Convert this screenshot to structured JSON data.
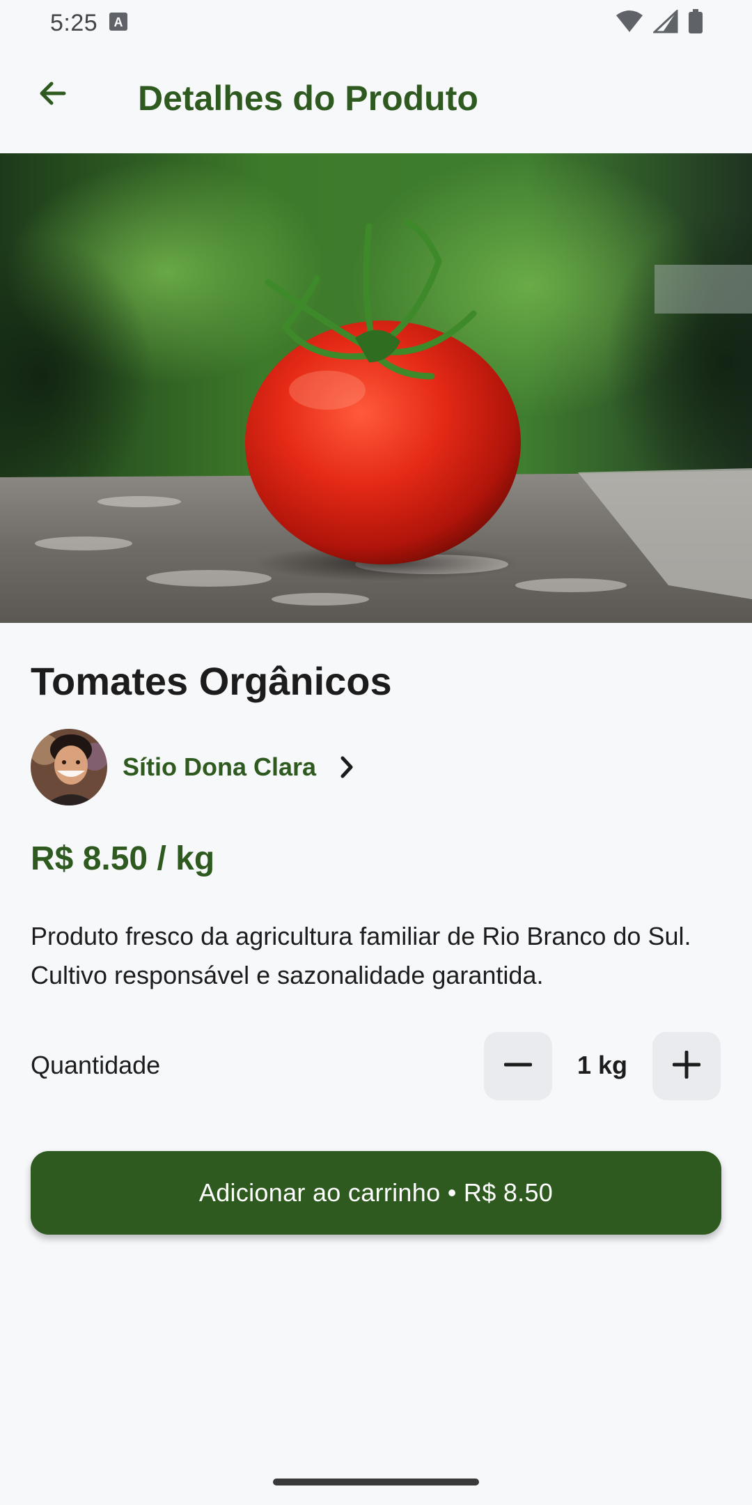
{
  "status_bar": {
    "time": "5:25",
    "icons": [
      "text-a-notification-icon",
      "wifi-icon",
      "cellular-signal-icon",
      "battery-icon"
    ]
  },
  "app_bar": {
    "back_icon": "arrow-left-icon",
    "title": "Detalhes do Produto"
  },
  "product": {
    "image": "tomato-photo",
    "title": "Tomates Orgânicos",
    "seller": {
      "avatar": "seller-avatar",
      "name": "Sítio Dona Clara",
      "chevron_icon": "chevron-right-icon"
    },
    "price": "R$ 8.50 / kg",
    "description": "Produto fresco da agricultura familiar de Rio Branco do Sul. Cultivo responsável e sazonalidade garantida."
  },
  "quantity": {
    "label": "Quantidade",
    "value": "1 kg",
    "decrement_icon": "minus-icon",
    "increment_icon": "plus-icon"
  },
  "cart_button": {
    "label": "Adicionar ao carrinho • R$ 8.50"
  },
  "colors": {
    "primary": "#2e5a1f",
    "background": "#f7f8fa",
    "stepper_bg": "#e9ebee"
  }
}
